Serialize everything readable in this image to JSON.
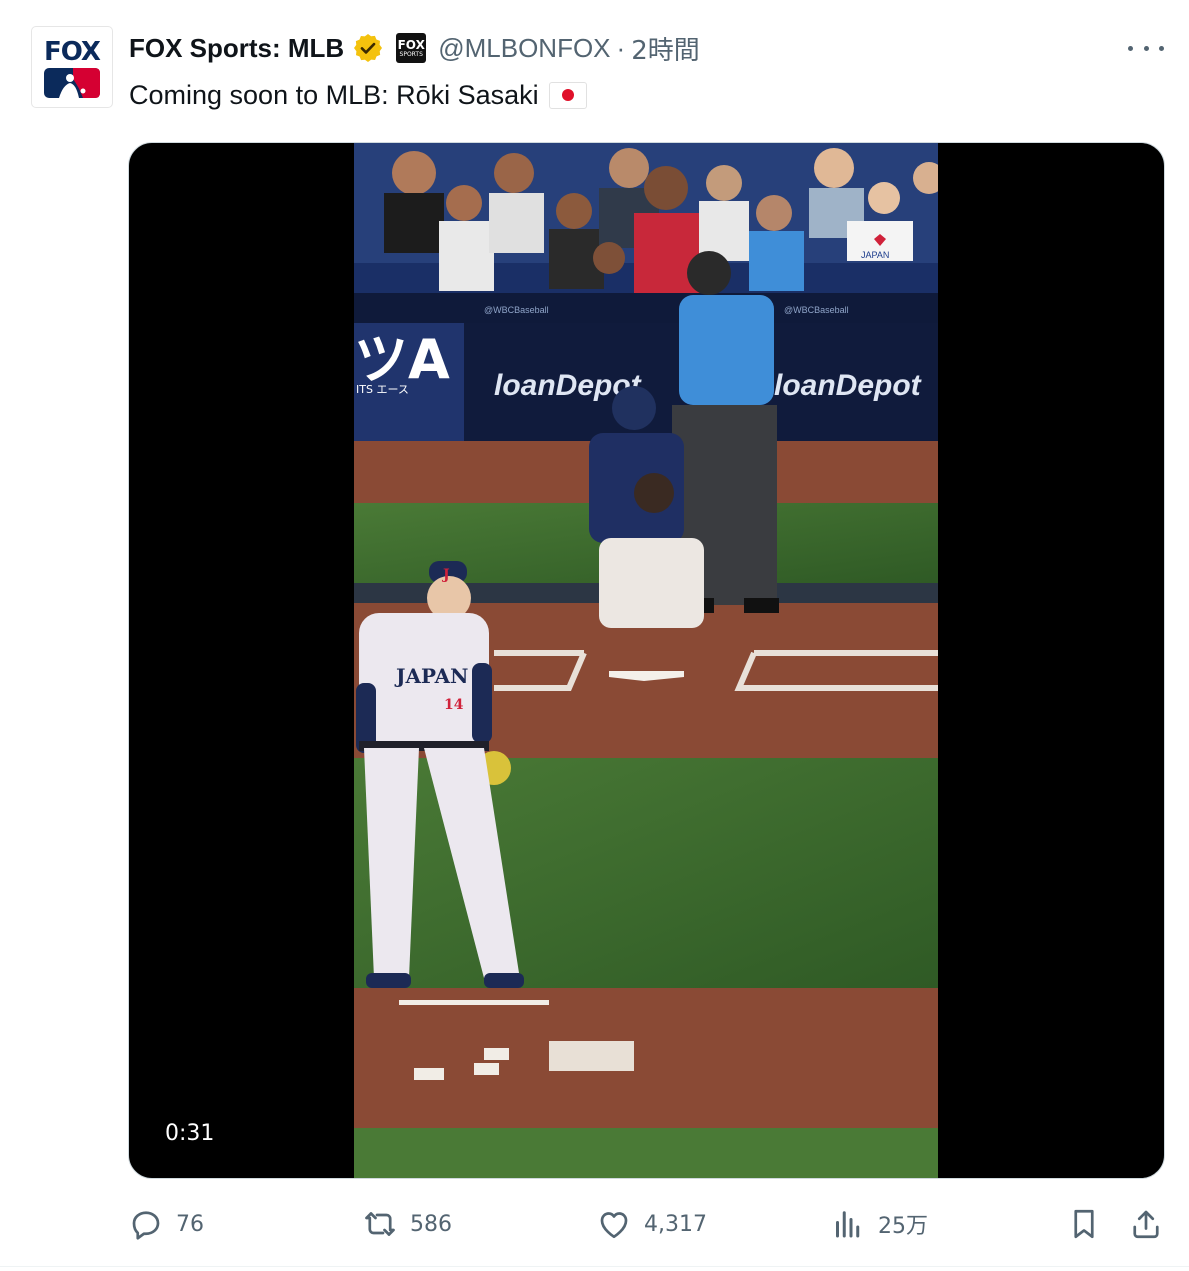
{
  "account": {
    "display_name": "FOX Sports: MLB",
    "handle": "@MLBONFOX",
    "separator": "·",
    "time": "2時間",
    "avatar_text": "FOX",
    "affiliate_badge_top": "FOX",
    "affiliate_badge_bottom": "SPORTS"
  },
  "tweet": {
    "text": "Coming soon to MLB: Rōki Sasaki",
    "flag_icon": "japan-flag"
  },
  "media": {
    "duration": "0:31",
    "scene_text": {
      "jersey": "JAPAN",
      "jersey_number": "14",
      "cap_letter": "J",
      "sign_left": "ツA",
      "sign_left_sub": "ITS エース",
      "sponsor": "loanDepot",
      "rail_text": "@WBCBaseball",
      "fan_sign": "JAPAN"
    }
  },
  "actions": {
    "replies": "76",
    "reposts": "586",
    "likes": "4,317",
    "views": "25万"
  },
  "colors": {
    "verified_gold": "#f4c20d",
    "secondary_text": "#536471",
    "field_green": "#3e6b2e",
    "dirt": "#8a4a35",
    "umpire_blue": "#3f8ed8"
  }
}
